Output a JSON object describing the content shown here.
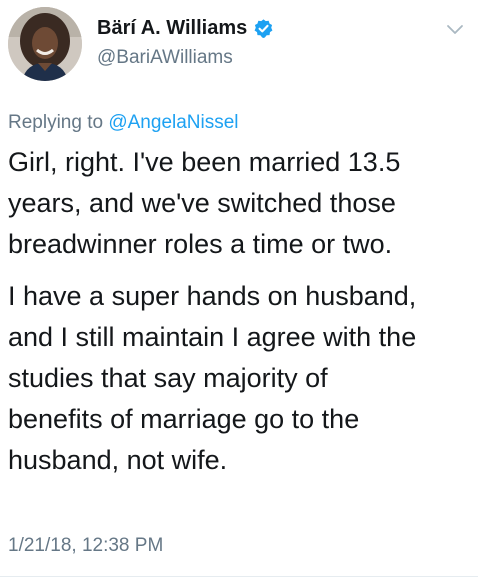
{
  "tweet": {
    "author": {
      "display_name": "Bärí A. Williams",
      "handle": "@BariAWilliams",
      "verified": true,
      "avatar_icon": "avatar-photo-icon"
    },
    "reply": {
      "prefix": "Replying to",
      "mention": "@AngelaNissel"
    },
    "paragraphs": [
      "Girl, right. I've been married 13.5\nyears, and we've switched those\nbreadwinner roles a time or two.",
      "I have a super hands on husband,\nand I still maintain I agree with the\nstudies that say majority of\nbenefits of marriage go to the\nhusband, not wife."
    ],
    "timestamp": "1/21/18, 12:38 PM"
  },
  "colors": {
    "verified_blue": "#1da1f2",
    "mention_blue": "#1da1f2",
    "secondary_text": "#657786",
    "primary_text": "#14171a"
  }
}
